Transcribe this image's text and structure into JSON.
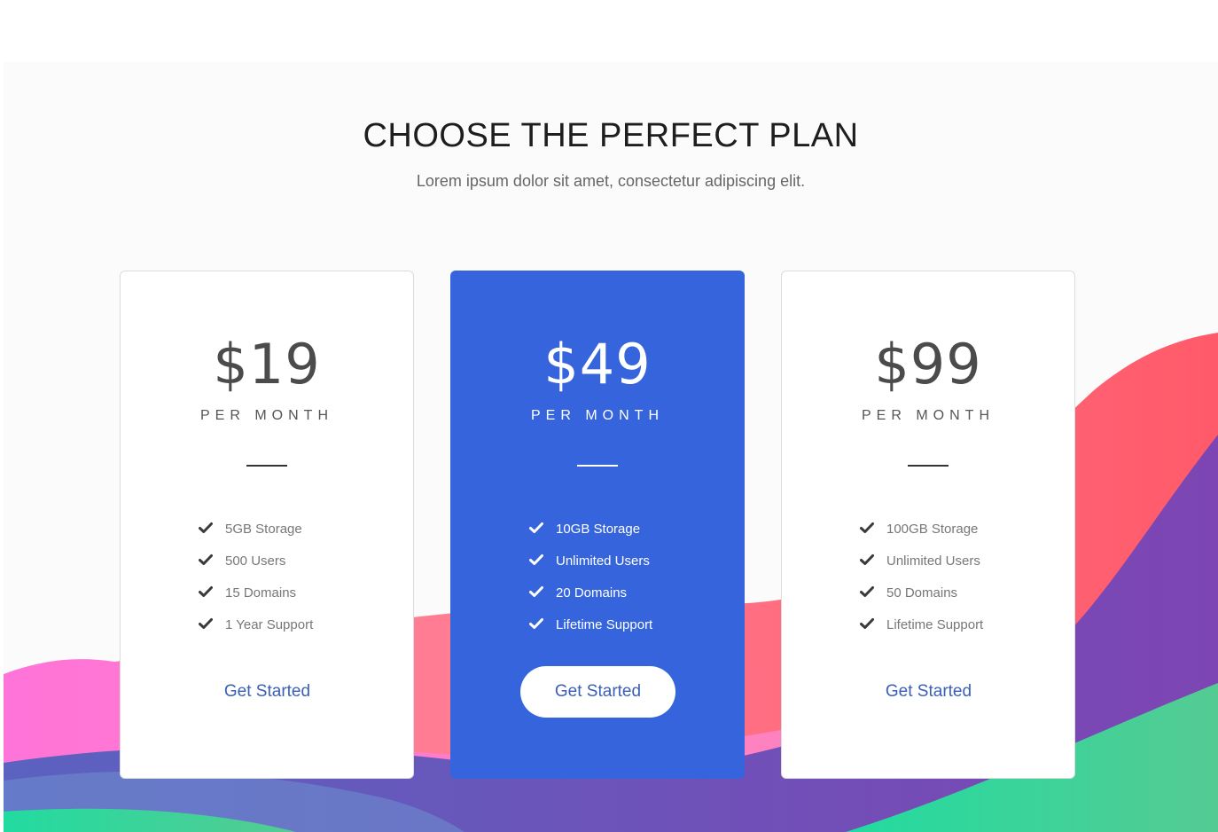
{
  "header": {
    "title": "CHOOSE THE PERFECT PLAN",
    "subtitle": "Lorem ipsum dolor sit amet, consectetur adipiscing elit."
  },
  "plans": [
    {
      "price": "$19",
      "period": "PER MONTH",
      "features": [
        "5GB Storage",
        "500 Users",
        "15 Domains",
        "1 Year Support"
      ],
      "cta": "Get Started",
      "featured": false
    },
    {
      "price": "$49",
      "period": "PER MONTH",
      "features": [
        "10GB Storage",
        "Unlimited Users",
        "20 Domains",
        "Lifetime Support"
      ],
      "cta": "Get Started",
      "featured": true
    },
    {
      "price": "$99",
      "period": "PER MONTH",
      "features": [
        "100GB Storage",
        "Unlimited Users",
        "50 Domains",
        "Lifetime Support"
      ],
      "cta": "Get Started",
      "featured": false
    }
  ],
  "icons": {
    "feature_icon": "check-icon"
  },
  "colors": {
    "accent": "#3564dd",
    "button_text": "#3a5fb5",
    "wave_coral": "#ff5f6d",
    "wave_pink": "#ff7ac6",
    "wave_purple": "#7b4fb0",
    "wave_green": "#2fd49a"
  }
}
